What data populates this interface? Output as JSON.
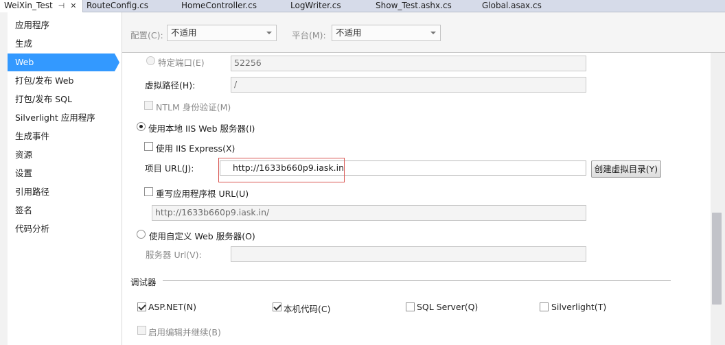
{
  "tabs": [
    {
      "label": "WeiXin_Test",
      "active": true
    },
    {
      "label": "RouteConfig.cs"
    },
    {
      "label": "HomeController.cs"
    },
    {
      "label": "LogWriter.cs"
    },
    {
      "label": "Show_Test.ashx.cs"
    },
    {
      "label": "Global.asax.cs"
    }
  ],
  "tab_icons": {
    "pin": "⊣",
    "close": "✕"
  },
  "sidebar": {
    "items": [
      {
        "label": "应用程序"
      },
      {
        "label": "生成"
      },
      {
        "label": "Web",
        "selected": true
      },
      {
        "label": "打包/发布 Web"
      },
      {
        "label": "打包/发布 SQL"
      },
      {
        "label": "Silverlight 应用程序"
      },
      {
        "label": "生成事件"
      },
      {
        "label": "资源"
      },
      {
        "label": "设置"
      },
      {
        "label": "引用路径"
      },
      {
        "label": "签名"
      },
      {
        "label": "代码分析"
      }
    ]
  },
  "config": {
    "config_label": "配置(C):",
    "config_value": "不适用",
    "platform_label": "平台(M):",
    "platform_value": "不适用"
  },
  "server": {
    "specific_port_label": "特定端口(E)",
    "specific_port_value": "52256",
    "virtual_path_label": "虚拟路径(H):",
    "virtual_path_value": "/",
    "ntlm_label": "NTLM 身份验证(M)",
    "local_iis_label": "使用本地 IIS Web 服务器(I)",
    "iis_express_label": "使用 IIS Express(X)",
    "project_url_label": "项目 URL(J):",
    "project_url_value": "http://1633b660p9.iask.in",
    "create_vdir_button": "创建虚拟目录(Y)",
    "override_root_label": "重写应用程序根 URL(U)",
    "override_root_value": "http://1633b660p9.iask.in/",
    "custom_server_label": "使用自定义 Web 服务器(O)",
    "server_url_label": "服务器 Url(V):",
    "server_url_value": ""
  },
  "debugger": {
    "heading": "调试器",
    "aspnet_label": "ASP.NET(N)",
    "aspnet_checked": true,
    "native_label": "本机代码(C)",
    "native_checked": true,
    "sql_label": "SQL Server(Q)",
    "sql_checked": false,
    "silverlight_label": "Silverlight(T)",
    "silverlight_checked": false,
    "edit_continue_label": "启用编辑并继续(B)"
  },
  "colors": {
    "accent": "#3399ff",
    "highlight_box": "#d9534f"
  }
}
